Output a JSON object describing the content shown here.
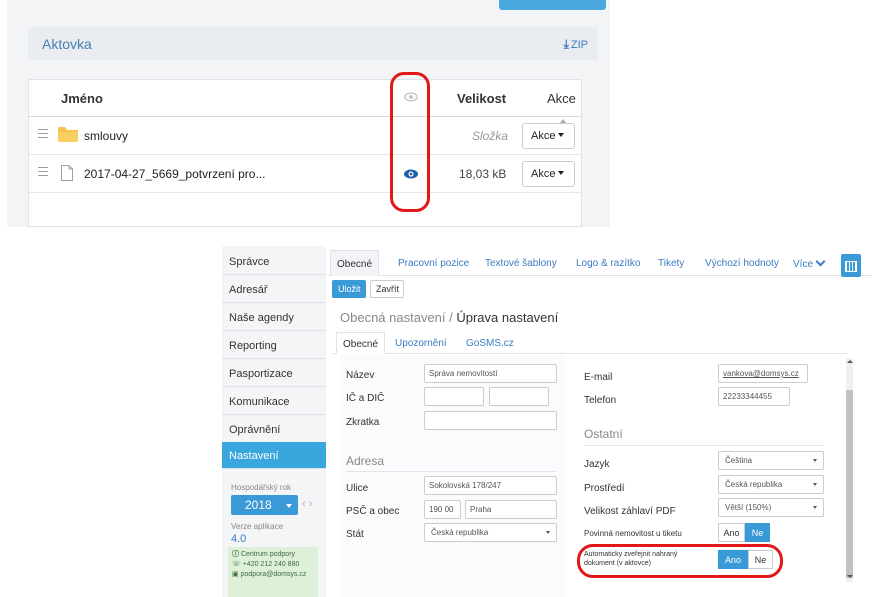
{
  "briefcase": {
    "title": "Aktovka",
    "zip_label": "ZIP",
    "columns": {
      "name": "Jméno",
      "size": "Velikost",
      "actions": "Akce"
    },
    "rows": [
      {
        "name": "smlouvy",
        "size": "Složka",
        "action": "Akce"
      },
      {
        "name": "2017-04-27_5669_potvrzení pro...",
        "size": "18,03 kB",
        "action": "Akce"
      }
    ]
  },
  "sidebar": {
    "items": [
      "Správce",
      "Adresář",
      "Naše agendy",
      "Reporting",
      "Pasportizace",
      "Komunikace",
      "Oprávnění",
      "Nastavení"
    ],
    "fiscal_year_label": "Hospodářský rok",
    "fiscal_year": "2018",
    "version_label": "Verze aplikace",
    "version": "4.0",
    "support": {
      "title": "Centrum podpory",
      "phone": "+420 212 240 880",
      "email": "podpora@domsys.cz"
    }
  },
  "tabs": [
    "Obecné",
    "Pracovní pozice",
    "Textové šablony",
    "Logo & razítko",
    "Tikety",
    "Výchozí hodnoty",
    "Více"
  ],
  "toolbar": {
    "save": "Uložit",
    "close": "Zavřít"
  },
  "page_title": {
    "prefix": "Obecná nastavení / ",
    "current": "Úprava nastavení"
  },
  "subtabs": [
    "Obecné",
    "Upozornění",
    "GoSMS.cz"
  ],
  "form": {
    "name_label": "Název",
    "name_value": "Správa nemovitostí",
    "ico_label": "IČ a DIČ",
    "short_label": "Zkratka",
    "address_heading": "Adresa",
    "street_label": "Ulice",
    "street_value": "Sokolovská 178/247",
    "zip_city_label": "PSČ a obec",
    "zip_value": "190 00",
    "city_value": "Praha",
    "country_label": "Stát",
    "country_value": "Česká republika",
    "email_label": "E-mail",
    "email_value": "vankova@domsys.cz",
    "phone_label": "Telefon",
    "phone_value": "22233344455",
    "other_heading": "Ostatní",
    "language_label": "Jazyk",
    "language_value": "Čeština",
    "env_label": "Prostředí",
    "env_value": "Česká republika",
    "pdf_label": "Velikost záhlaví PDF",
    "pdf_value": "Větší (150%)",
    "req_property_label": "Povinná nemovitost u tiketu",
    "req_property": "Ne",
    "auto_publish_label": "Automaticky zveřejnit nahraný dokument (v aktovce)",
    "auto_publish": "Ano",
    "yes": "Ano",
    "no": "Ne"
  }
}
